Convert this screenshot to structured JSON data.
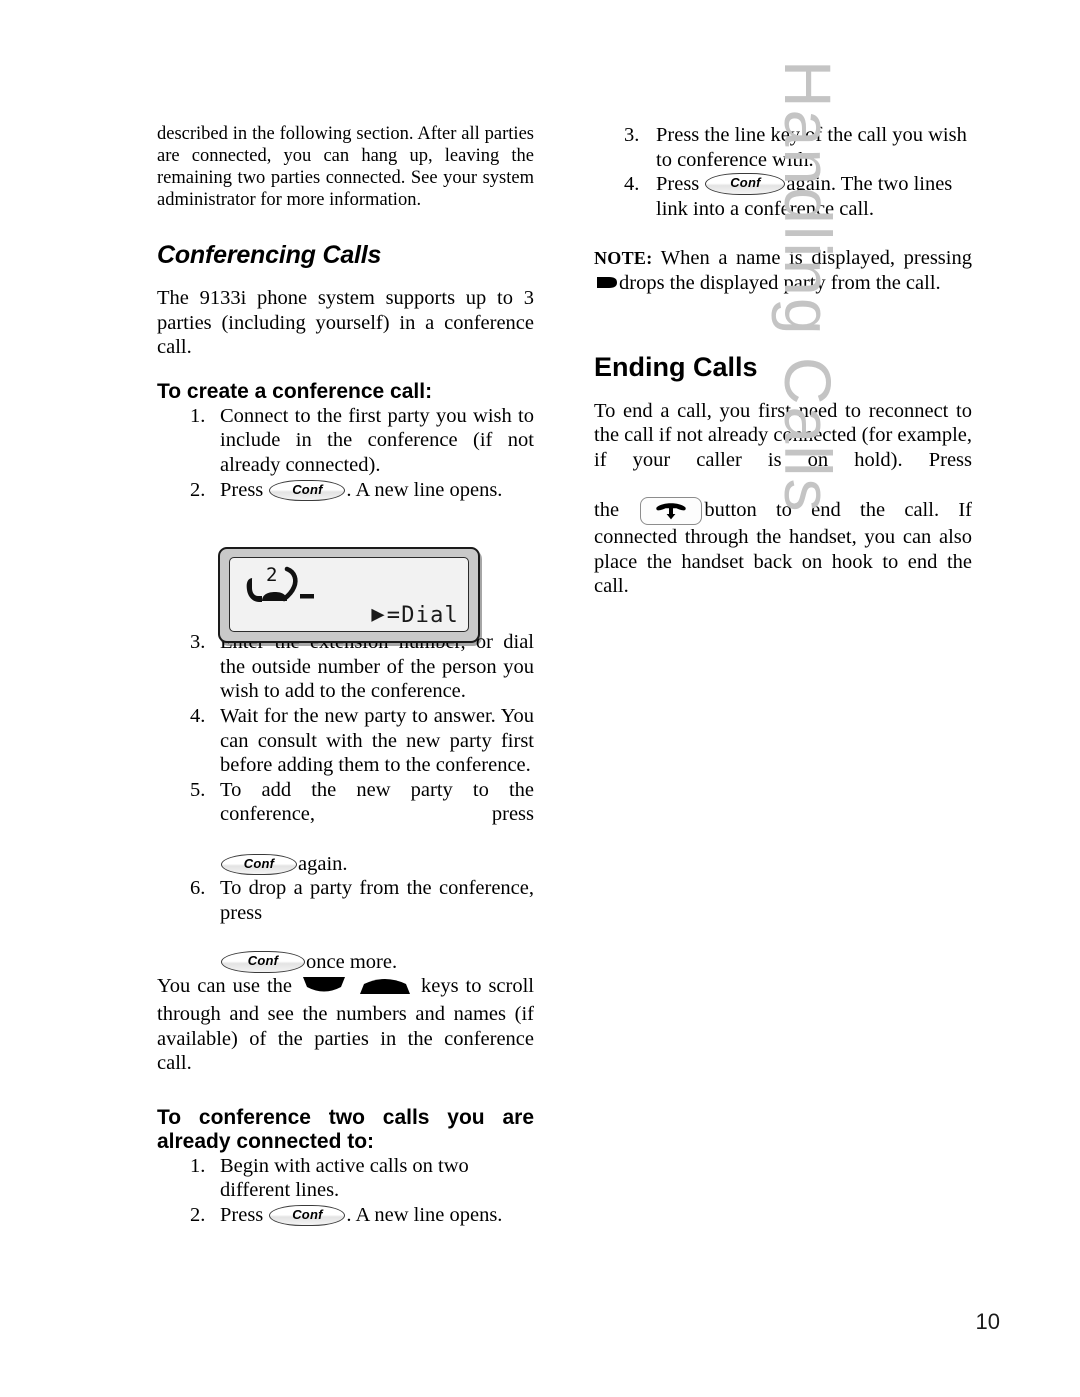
{
  "page": {
    "number": "10",
    "side_tab": "Handling Calls",
    "side_tab_color": "#c4c4c4"
  },
  "left_column": {
    "intro_paragraph": "described in the following section. After all parties are connected, you can hang up, leaving the remaining two parties connected. See your system administrator for more information.",
    "heading_conferencing": "Conferencing Calls",
    "conferencing_paragraph": "The 9133i phone system supports up to 3 parties (including yourself) in a conference call.",
    "heading_create": "To create a conference call",
    "heading_create_colon": ":",
    "create_steps": [
      {
        "num": "1.",
        "text": "Connect to the first party you wish to include in the conference (if not already connected)."
      },
      {
        "num": "2.",
        "before": "Press",
        "key": "Conf",
        "after": ". A new line opens."
      },
      {
        "num": "3.",
        "text": "Enter the extension number, or dial the outside number of the person you wish to add to the conference."
      },
      {
        "num": "4.",
        "text": "Wait for the new party to answer. You can consult with the new party first before adding them to the conference."
      },
      {
        "num": "5.",
        "before": "To add the new party to the conference, press",
        "key": "Conf",
        "after": "again."
      },
      {
        "num": "6.",
        "before": "To drop a party from the conference, press",
        "key": "Conf",
        "after": "once more."
      }
    ],
    "scroll_paragraph": {
      "before": "You can use the",
      "key_down": "down-arrow-key",
      "key_up": "up-arrow-key",
      "after": "keys to scroll through and see the numbers and names (if available) of the parties in the conference call."
    },
    "heading_two_calls": "To conference two calls you are already connected to:",
    "two_calls_steps": [
      {
        "num": "1.",
        "text": "Begin with active calls on two different lines."
      },
      {
        "num": "2.",
        "before": "Press",
        "key": "Conf",
        "after": ". A new line opens."
      }
    ],
    "lcd_figure": {
      "line_indicator": "2",
      "softkey_label": "=Dial",
      "softkey_arrow": "▶"
    }
  },
  "right_column": {
    "conference_steps": [
      {
        "num": "3.",
        "text": "Press the line key of the call you wish to conference with."
      },
      {
        "num": "4.",
        "before": "Press",
        "key": "Conf",
        "after": "again. The two lines link into a conference call."
      }
    ],
    "note": {
      "label": "NOTE:",
      "before": "When a name is displayed, pressing",
      "glyph": "drop-arrow-icon",
      "after": "drops the displayed party from the call."
    },
    "heading_ending": "Ending Calls",
    "ending_paragraph_1": "To end a call, you first need to reconnect to the call if not already connected (for example, if your caller is on hold). Press",
    "ending_the": "the",
    "ending_key": "goodbye-button",
    "ending_paragraph_2": "button to end the call. If connected through the handset, you can also place the handset back on hook to end the call."
  }
}
